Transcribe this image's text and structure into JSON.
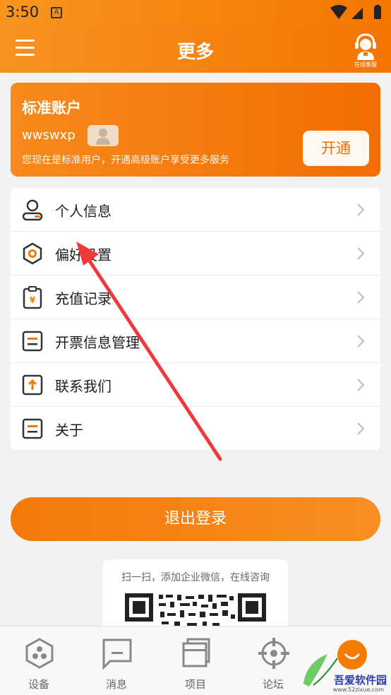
{
  "status_bar": {
    "time": "3:50",
    "notification_badge": "A"
  },
  "app_bar": {
    "title": "更多",
    "service_label": "在线客服"
  },
  "account_card": {
    "title": "标准账户",
    "username": "wwswxp",
    "description": "您现在是标准用户，开通高级账户享受更多服务",
    "open_button": "开通"
  },
  "menu": [
    {
      "label": "个人信息",
      "icon": "person-icon"
    },
    {
      "label": "偏好设置",
      "icon": "settings-icon"
    },
    {
      "label": "充值记录",
      "icon": "recharge-icon"
    },
    {
      "label": "开票信息管理",
      "icon": "invoice-icon"
    },
    {
      "label": "联系我们",
      "icon": "contact-icon"
    },
    {
      "label": "关于",
      "icon": "about-icon"
    }
  ],
  "logout_button": "退出登录",
  "qr_section": {
    "text": "扫一扫，添加企业微信，在线咨询"
  },
  "tabs": [
    {
      "label": "设备",
      "icon": "device-icon"
    },
    {
      "label": "消息",
      "icon": "message-icon"
    },
    {
      "label": "项目",
      "icon": "project-icon"
    },
    {
      "label": "论坛",
      "icon": "forum-icon"
    },
    {
      "label": "",
      "icon": "more-icon"
    }
  ],
  "watermark": {
    "text": "吾爱软件园",
    "url": "www.52zixue.com"
  },
  "colors": {
    "accent": "#f57a00",
    "accent_light": "#f79320",
    "text": "#1e1e1e",
    "muted": "#666666"
  }
}
